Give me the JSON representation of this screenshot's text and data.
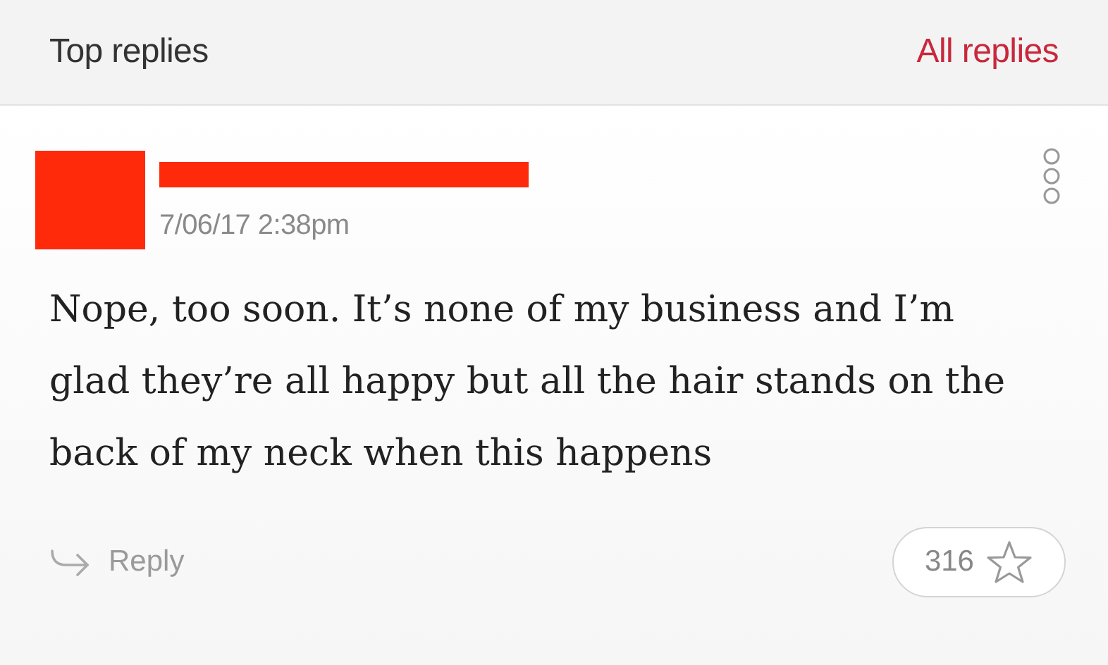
{
  "header": {
    "title": "Top replies",
    "link": "All replies"
  },
  "reply": {
    "date": "7/06/17 2:38pm",
    "body": "Nope, too soon. It’s none of my business and I’m glad they’re all happy but all the hair stands on the back of my neck when this happens",
    "action": "Reply",
    "likes": "316"
  }
}
